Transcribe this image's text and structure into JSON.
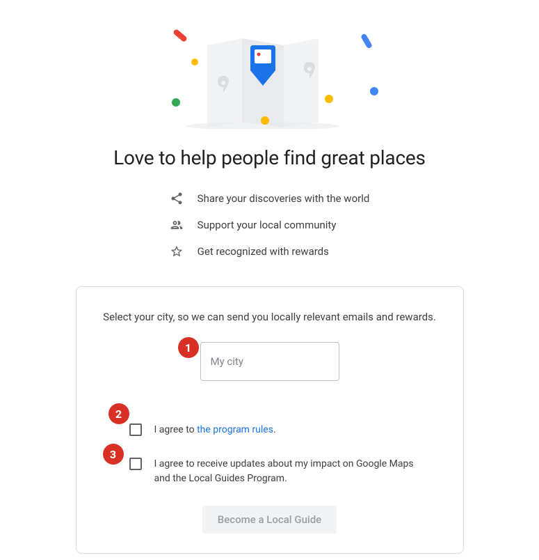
{
  "heading": "Love to help people find great places",
  "benefits": [
    {
      "text": "Share your discoveries with the world"
    },
    {
      "text": "Support your local community"
    },
    {
      "text": "Get recognized with rewards"
    }
  ],
  "card": {
    "prompt": "Select your city, so we can send you locally relevant emails and rewards.",
    "city_placeholder": "My city",
    "agree_prefix": "I agree to ",
    "agree_link": "the program rules",
    "agree_suffix": ".",
    "updates_text": "I agree to receive updates about my impact on Google Maps and the Local Guides Program.",
    "cta": "Become a Local Guide"
  },
  "markers": {
    "m1": "1",
    "m2": "2",
    "m3": "3"
  }
}
